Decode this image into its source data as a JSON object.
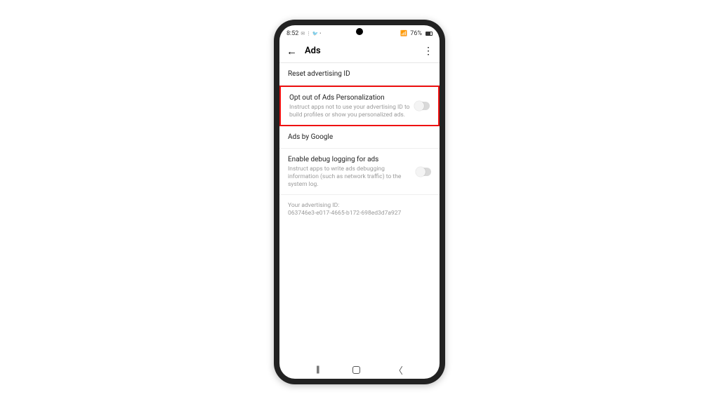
{
  "status": {
    "time": "8:52",
    "icons_left": "✉ ⋮ 🐦 •",
    "battery_pct": "76%"
  },
  "header": {
    "title": "Ads"
  },
  "rows": {
    "reset": {
      "title": "Reset advertising ID"
    },
    "optout": {
      "title": "Opt out of Ads Personalization",
      "desc": "Instruct apps not to use your advertising ID to build profiles or show you personalized ads."
    },
    "adsby": {
      "title": "Ads by Google"
    },
    "debug": {
      "title": "Enable debug logging for ads",
      "desc": "Instruct apps to write ads debugging information (such as network traffic) to the system log."
    }
  },
  "ad_id": {
    "label": "Your advertising ID:",
    "value": "063746e3-e017-4665-b172-698ed3d7a927"
  }
}
